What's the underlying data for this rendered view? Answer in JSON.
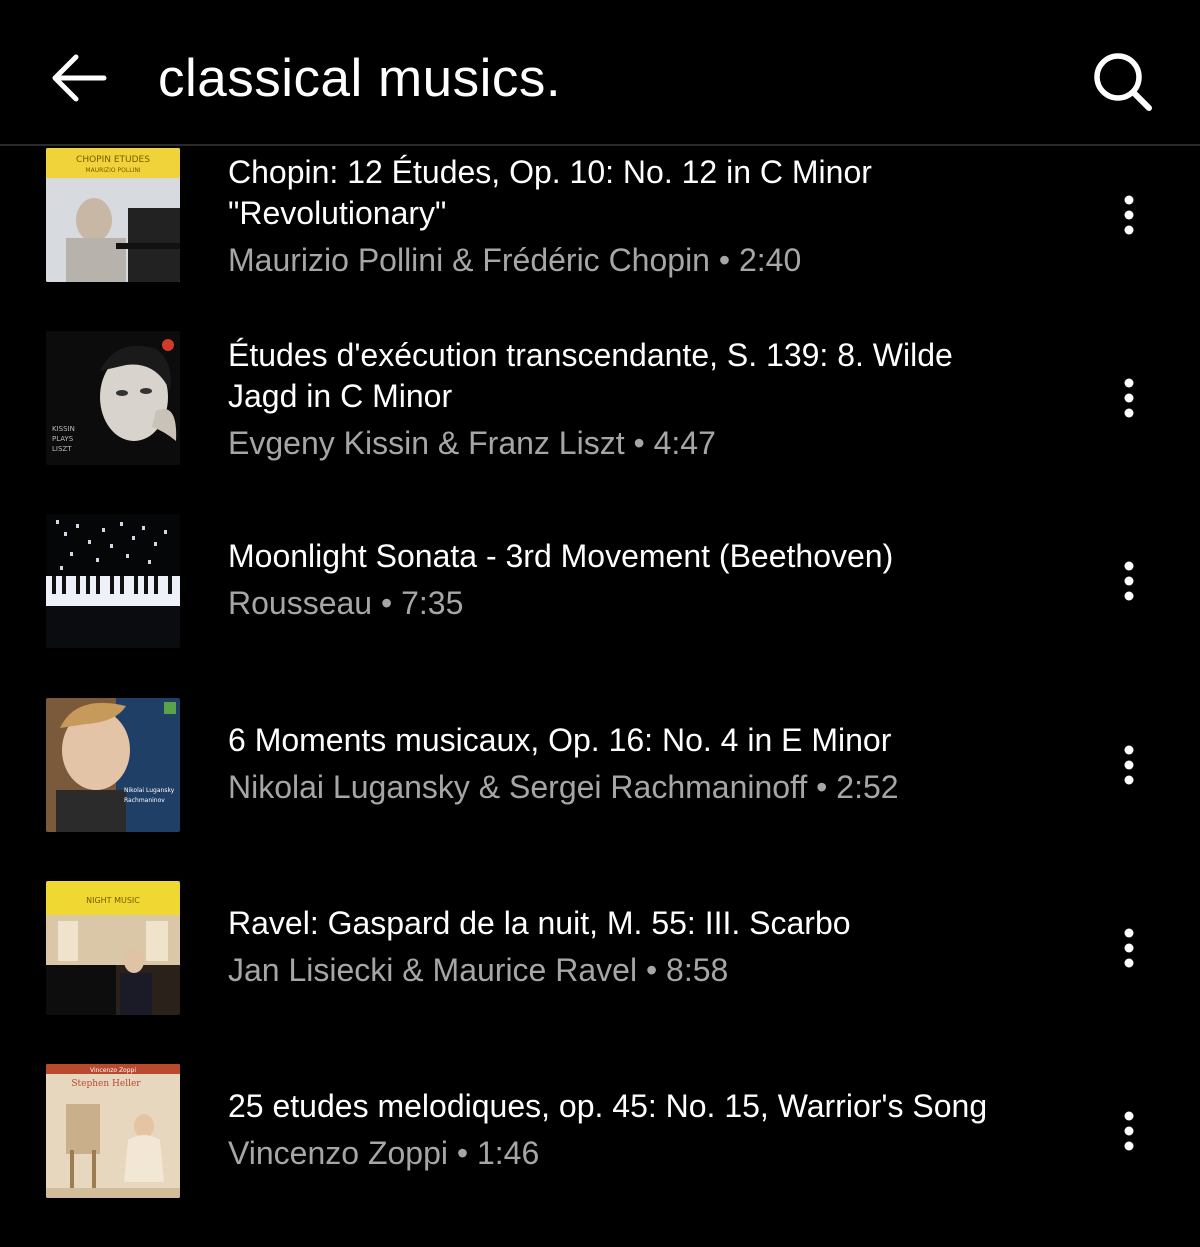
{
  "header": {
    "query": "classical musics.",
    "back_icon": "arrow-left-icon",
    "search_icon": "search-icon"
  },
  "colors": {
    "background": "#000000",
    "title_text": "#ffffff",
    "secondary_text": "#a6a6a6"
  },
  "results": [
    {
      "title_line1": "Chopin: 12 Études, Op. 10: No. 12 in C Minor",
      "title_line2": "\"Revolutionary\"",
      "subtitle": "Maurizio Pollini & Frédéric Chopin • 2:40",
      "thumb_text": "CHOPIN ETUDES",
      "more_icon": "more-vertical-icon"
    },
    {
      "title_line1": "Études d'exécution transcendante, S. 139: 8. Wilde",
      "title_line2": "Jagd in C Minor",
      "subtitle": "Evgeny Kissin & Franz Liszt • 4:47",
      "thumb_text": "KISSIN PLAYS LISZT",
      "more_icon": "more-vertical-icon"
    },
    {
      "title_line1": "Moonlight Sonata - 3rd Movement (Beethoven)",
      "title_line2": "",
      "subtitle": "Rousseau • 7:35",
      "thumb_text": "",
      "more_icon": "more-vertical-icon"
    },
    {
      "title_line1": "6 Moments musicaux, Op. 16: No. 4 in E Minor",
      "title_line2": "",
      "subtitle": "Nikolai Lugansky & Sergei Rachmaninoff • 2:52",
      "thumb_text": "Nikolai Lugansky Rachmaninov",
      "more_icon": "more-vertical-icon"
    },
    {
      "title_line1": "Ravel: Gaspard de la nuit, M. 55: III. Scarbo",
      "title_line2": "",
      "subtitle": "Jan Lisiecki & Maurice Ravel • 8:58",
      "thumb_text": "NIGHT MUSIC",
      "more_icon": "more-vertical-icon"
    },
    {
      "title_line1": "25 etudes melodiques, op. 45: No. 15, Warrior's Song",
      "title_line2": "",
      "subtitle": "Vincenzo Zoppi • 1:46",
      "thumb_text": "Vincenzo Zoppi Stephen Heller",
      "more_icon": "more-vertical-icon"
    }
  ]
}
